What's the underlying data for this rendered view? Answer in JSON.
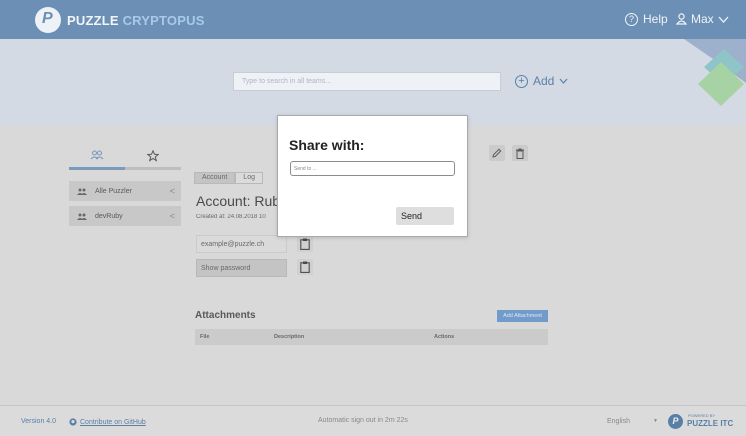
{
  "header": {
    "brand_part1": "PUZZLE",
    "brand_part2": "CRYPTOPUS",
    "help_label": "Help",
    "user_label": "Max"
  },
  "search": {
    "placeholder": "Type to search in all teams..."
  },
  "add": {
    "label": "Add"
  },
  "sidebar": {
    "items": [
      {
        "label": "Alle Puzzler"
      },
      {
        "label": "devRuby"
      }
    ]
  },
  "account": {
    "tabs": [
      {
        "label": "Account"
      },
      {
        "label": "Log"
      }
    ],
    "title": "Account: Rub",
    "created": "Created at: 24.08.2018 10",
    "email": "example@puzzle.ch",
    "password_label": "Show password"
  },
  "attachments": {
    "title": "Attachments",
    "add_label": "Add Attachment",
    "columns": [
      "File",
      "Description",
      "Actions"
    ]
  },
  "dialog": {
    "title": "Share with:",
    "input_placeholder": "Send to ...",
    "send_label": "Send"
  },
  "footer": {
    "version": "Version 4.0",
    "github": "Contribute on GitHub",
    "signout": "Automatic sign out in 2m 22s",
    "language": "English",
    "powered_small": "POWERED BY",
    "powered_big": "PUZZLE ITC"
  },
  "colors": {
    "header": "#6b8fb5",
    "banner": "#d3dae4",
    "accent": "#5a7fa7",
    "attachment_button": "#6fa0d6"
  }
}
